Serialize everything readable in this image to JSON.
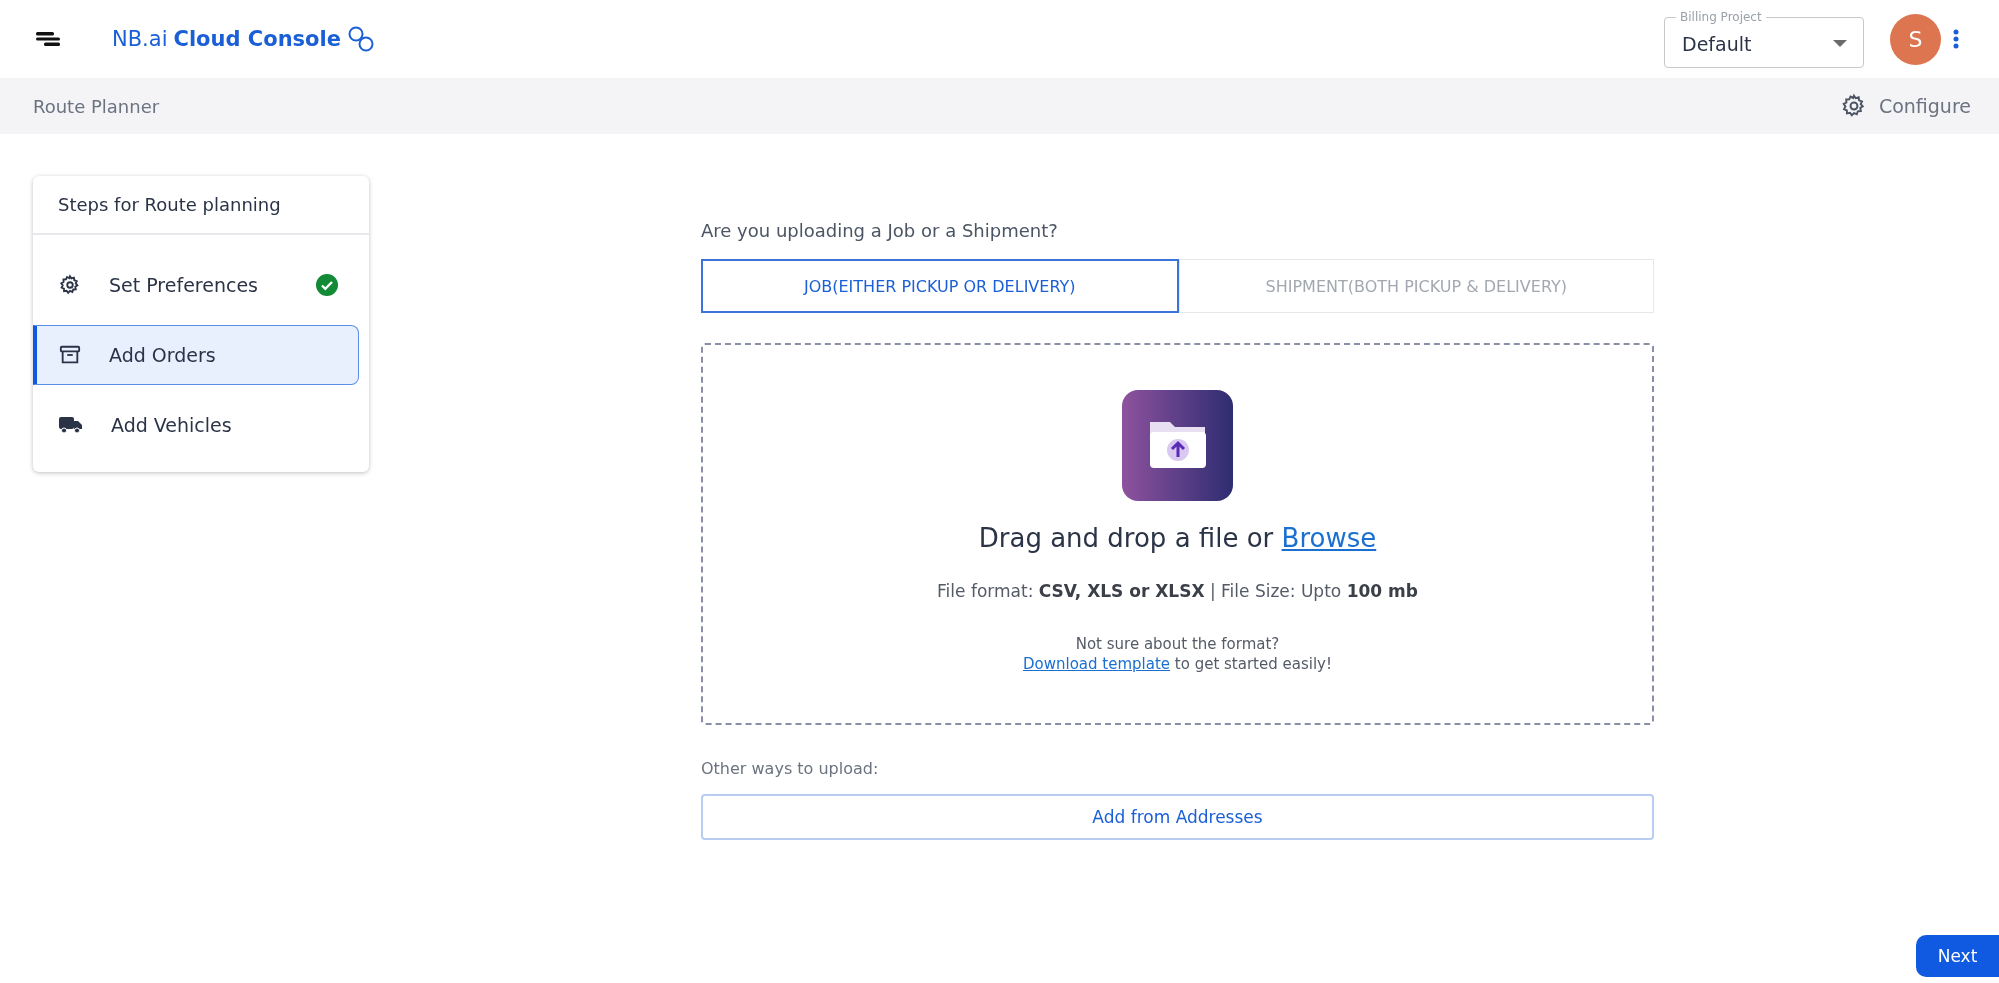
{
  "header": {
    "brand_prefix": "NB.ai",
    "brand_name": "Cloud Console",
    "billing": {
      "label": "Billing Project",
      "value": "Default"
    },
    "avatar": "S"
  },
  "subheader": {
    "title": "Route Planner",
    "configure": "Configure"
  },
  "steps": {
    "title": "Steps for Route planning",
    "items": [
      {
        "kind": "gear",
        "label": "Set Preferences",
        "done": true,
        "selected": false
      },
      {
        "kind": "box",
        "label": "Add Orders",
        "done": false,
        "selected": true
      },
      {
        "kind": "truck",
        "label": "Add Vehicles",
        "done": false,
        "selected": false
      }
    ]
  },
  "upload": {
    "question": "Are you uploading a Job or a Shipment?",
    "tabs": [
      {
        "label": "JOB(EITHER PICKUP OR DELIVERY)",
        "selected": true
      },
      {
        "label": "SHIPMENT(BOTH PICKUP & DELIVERY)",
        "selected": false
      }
    ],
    "drop_text": "Drag and drop a file or",
    "browse": "Browse",
    "format_info": "File format: **CSV, XLS or XLSX** | File Size: Upto **100 mb**",
    "hint": "Not sure about the format?",
    "template_link": "Download template",
    "template_rest": "to get started easily!",
    "other_label": "Other ways to upload:",
    "other_button": "Add from Addresses"
  },
  "next": "Next"
}
